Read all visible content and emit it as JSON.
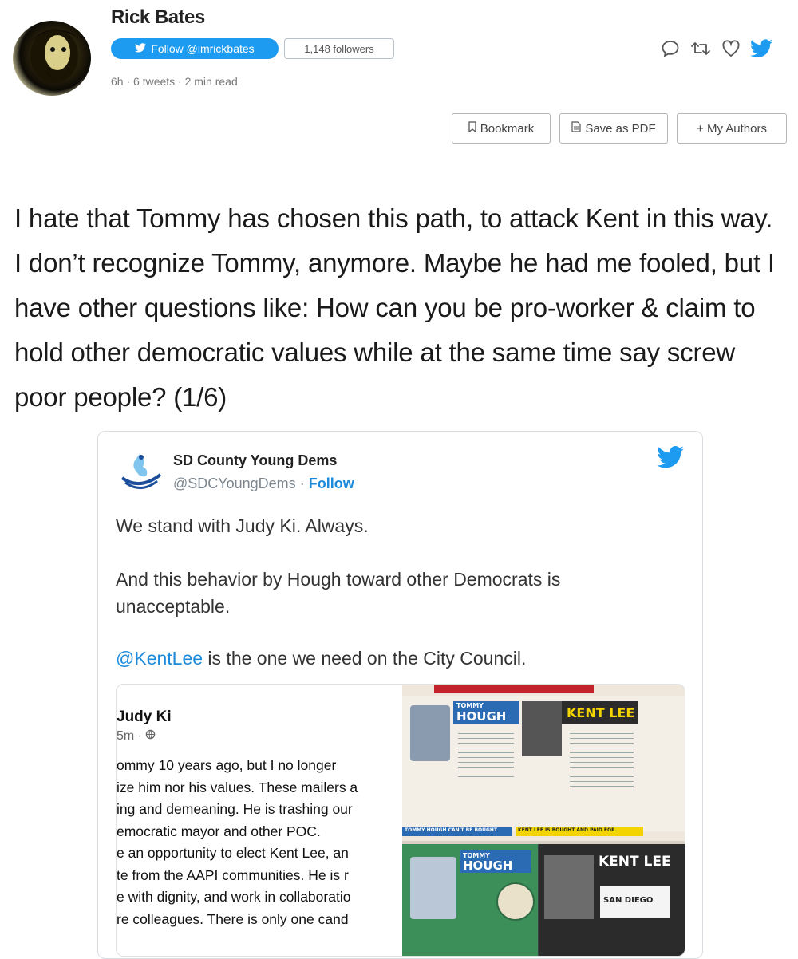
{
  "author": {
    "name": "Rick Bates",
    "follow_label": "Follow @imrickbates",
    "followers": "1,148 followers",
    "meta": "6h · 6 tweets · 2 min read"
  },
  "toolbar": {
    "bookmark": "Bookmark",
    "save_pdf": "Save as PDF",
    "my_authors": "+ My Authors"
  },
  "tweet": {
    "text": "I hate that Tommy has chosen this path, to attack Kent in this way. I don’t recognize Tommy, anymore. Maybe he had me fooled, but I have other questions like: How can you be pro-worker & claim to hold other democratic values while at the same time say screw poor people? (1/6)"
  },
  "embed": {
    "name": "SD County Young Dems",
    "handle": "@SDCYoungDems",
    "follow": "Follow",
    "line1": "We stand with Judy Ki. Always.",
    "line2": "And this behavior by Hough toward other Democrats is unacceptable.",
    "mention": "@KentLee",
    "line3_rest": " is the one we need on the City Council.",
    "fb": {
      "name": "Judy Ki",
      "time": "5m · ",
      "lines": [
        "ommy 10 years ago, but I no longer",
        "ize him nor his values. These mailers a",
        "ing and demeaning. He is trashing our",
        "emocratic mayor and other POC.",
        "e an opportunity to elect Kent Lee, an",
        "te from the AAPI communities. He is r",
        "e with dignity, and work in collaboratio",
        "re colleagues. There is only one cand"
      ]
    },
    "mailer": {
      "hough_top": "TOMMY",
      "hough_big": "HOUGH",
      "kent": "KENT LEE",
      "footer_left": "TOMMY HOUGH CAN'T BE BOUGHT",
      "footer_right": "KENT LEE IS BOUGHT AND PAID FOR.",
      "sd": "SAN DIEGO"
    }
  },
  "colors": {
    "twitter_blue": "#1d9bf0",
    "link_blue": "#1d8bdb"
  }
}
